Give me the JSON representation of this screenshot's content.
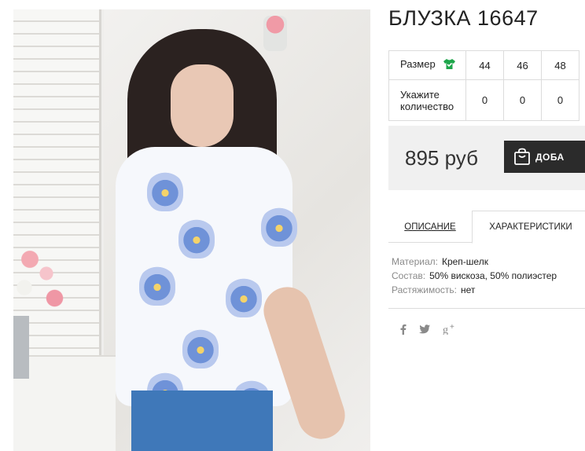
{
  "product": {
    "title": "БЛУЗКА 16647"
  },
  "sizes_table": {
    "size_label": "Размер",
    "quantity_label": "Укажите количество",
    "sizes": [
      "44",
      "46",
      "48"
    ],
    "quantities": [
      "0",
      "0",
      "0"
    ]
  },
  "purchase": {
    "price": "895 руб",
    "add_to_cart_label": "ДОБА"
  },
  "tabs": [
    {
      "label": "ОПИСАНИЕ"
    },
    {
      "label": "ХАРАКТЕРИСТИКИ"
    }
  ],
  "specs": [
    {
      "key": "Материал:",
      "value": "Креп-шелк"
    },
    {
      "key": "Состав:",
      "value": "50% вискоза, 50% полиэстер"
    },
    {
      "key": "Растяжимость:",
      "value": "нет"
    }
  ],
  "social": [
    {
      "icon": "facebook-icon",
      "glyph": "f"
    },
    {
      "icon": "twitter-icon",
      "glyph": "🐦"
    },
    {
      "icon": "google-plus-icon",
      "glyph": "g⁺"
    }
  ],
  "colors": {
    "accent_green": "#1ea64b",
    "button_dark": "#2b2b2b",
    "price_box_bg": "#f0f0f0"
  }
}
